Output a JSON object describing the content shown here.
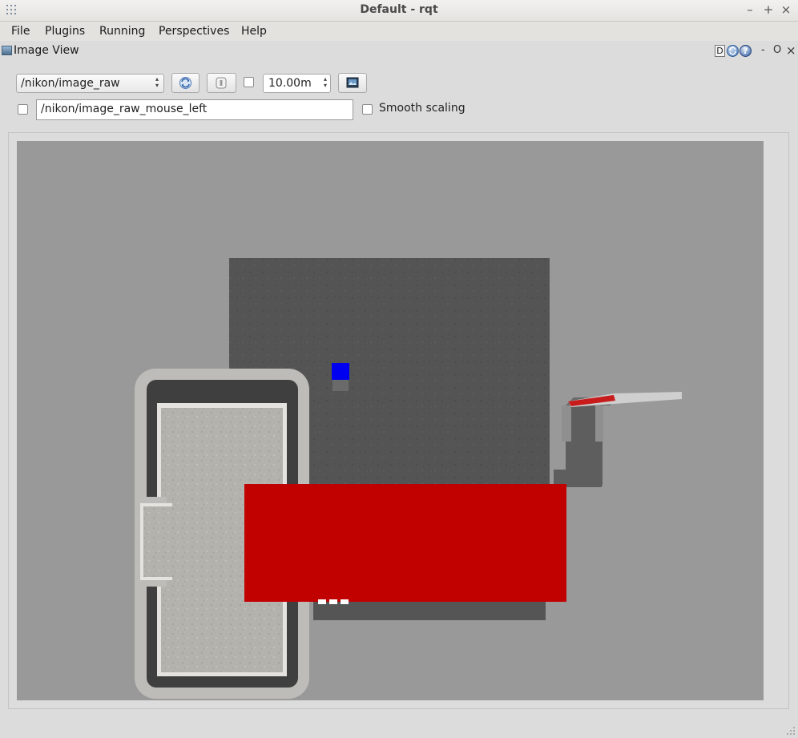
{
  "window": {
    "title": "Default - rqt"
  },
  "menubar": {
    "items": [
      "File",
      "Plugins",
      "Running",
      "Perspectives",
      "Help"
    ]
  },
  "dock": {
    "title": "Image View",
    "d_label": "D",
    "minimize_label": "-",
    "float_label": "O",
    "close_label": "×"
  },
  "toolbar": {
    "topic_value": "/nikon/image_raw",
    "zoom_value": "10.00m",
    "mouse_topic_value": "/nikon/image_raw_mouse_left",
    "smooth_scaling_label": "Smooth scaling",
    "smooth_scaling_checked": false,
    "mouse_publish_checked": false,
    "zoom_checked": false
  },
  "window_controls": {
    "minimize": "–",
    "maximize": "+",
    "close": "×"
  },
  "colors": {
    "canvas_bg": "#999999",
    "ground_dark": "#545454",
    "red_box": "#c10000",
    "blue_marker": "#0000f0"
  }
}
